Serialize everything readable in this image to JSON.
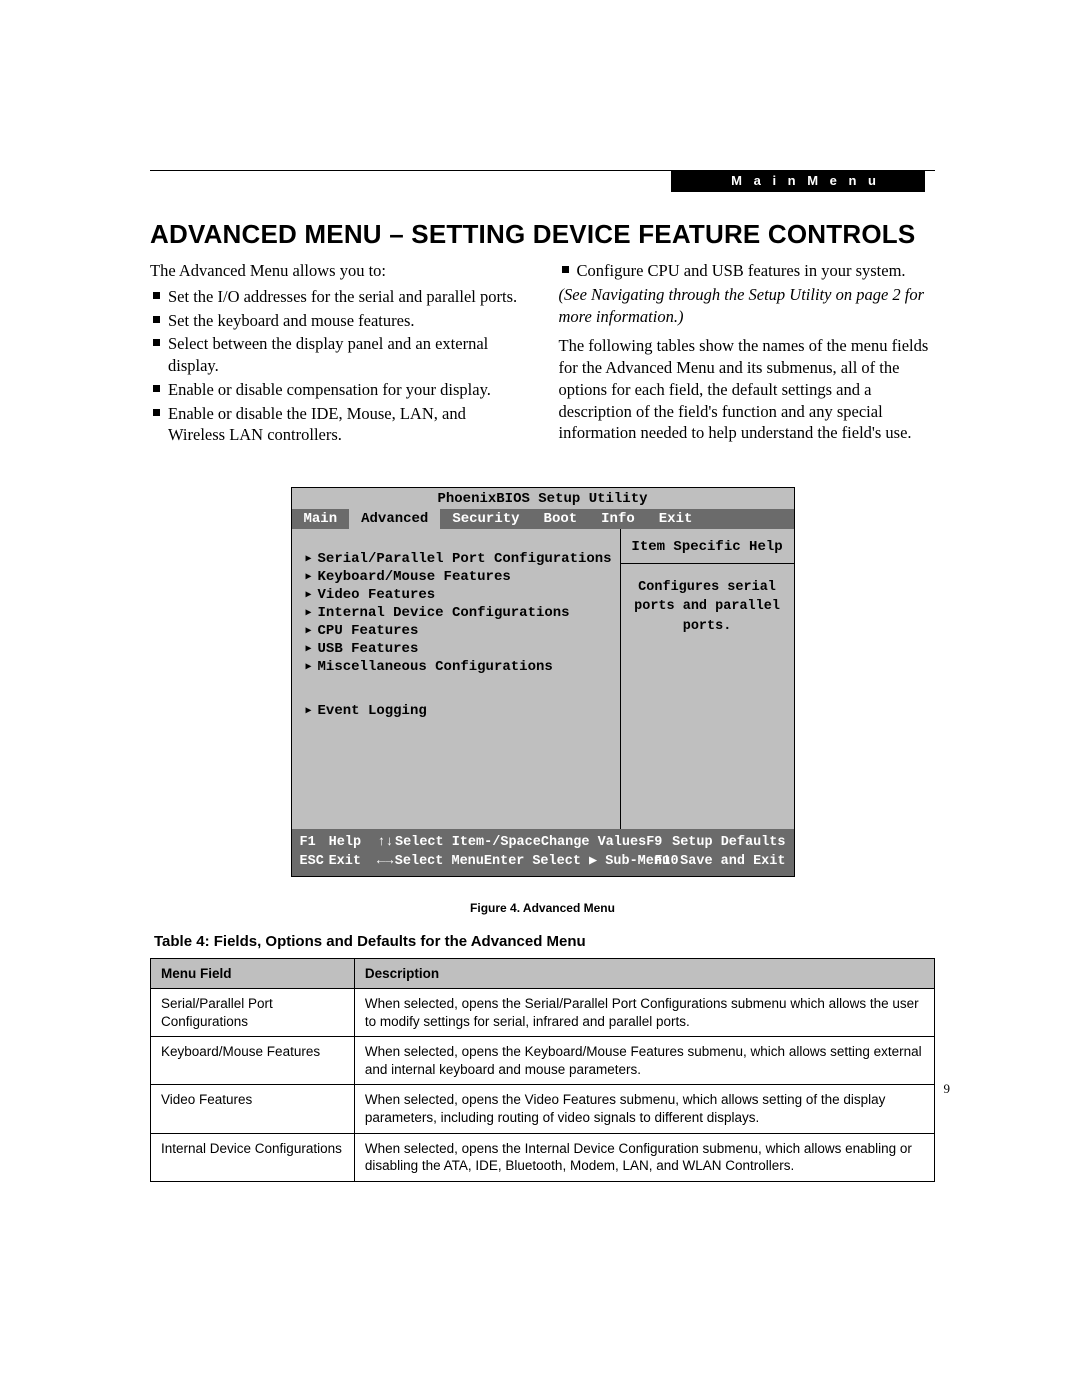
{
  "header": {
    "tag": "M a i n   M e n u"
  },
  "title": "ADVANCED MENU – SETTING DEVICE FEATURE CONTROLS",
  "intro": "The Advanced Menu allows you to:",
  "bullets_left": [
    "Set the I/O addresses for the serial and parallel ports.",
    "Set the keyboard and mouse features.",
    "Select between the display panel and an external display.",
    "Enable or disable compensation for your display.",
    "Enable or disable the IDE, Mouse, LAN, and Wireless LAN controllers."
  ],
  "bullet_right": "Configure CPU and USB features in your system.",
  "see_note": "(See Navigating through the Setup Utility on page 2 for more information.)",
  "para_right": "The following tables show the names of the menu fields for the Advanced Menu and its submenus, all of the options for each field, the default settings and a description of the field's function and any special information needed to help understand the field's use.",
  "bios": {
    "title": "PhoenixBIOS Setup Utility",
    "tabs": [
      "Main",
      "Advanced",
      "Security",
      "Boot",
      "Info",
      "Exit"
    ],
    "active_tab": "Advanced",
    "items_block1": [
      "Serial/Parallel Port Configurations",
      "Keyboard/Mouse Features",
      "Video Features",
      "Internal Device Configurations",
      "CPU Features",
      "USB Features",
      "Miscellaneous Configurations"
    ],
    "items_block2": [
      "Event Logging"
    ],
    "help_title": "Item Specific Help",
    "help_text": "Configures serial ports and parallel ports.",
    "footer": {
      "r1": {
        "k1": "F1",
        "k2": "Help",
        "arr1": "↑↓",
        "k3": "Select Item",
        "k4": "-/Space",
        "k5": "Change Values",
        "k6": "F9",
        "k7": "Setup Defaults"
      },
      "r2": {
        "k1": "ESC",
        "k2": "Exit",
        "arr1": "←→",
        "k3": "Select Menu",
        "k4": "Enter",
        "k5": "Select ▶ Sub-Menu",
        "k6": "F10",
        "k7": "Save and Exit"
      }
    }
  },
  "figure_caption": "Figure 4.  Advanced Menu",
  "table_title": "Table 4: Fields, Options and Defaults for the Advanced Menu",
  "table": {
    "headers": [
      "Menu Field",
      "Description"
    ],
    "rows": [
      {
        "field": "Serial/Parallel Port Configurations",
        "desc": "When selected, opens the Serial/Parallel Port Configurations submenu which allows the user to modify settings for serial, infrared and parallel ports."
      },
      {
        "field": "Keyboard/Mouse Features",
        "desc": "When selected, opens the Keyboard/Mouse Features submenu, which allows setting external and internal keyboard and mouse parameters."
      },
      {
        "field": "Video Features",
        "desc": "When selected, opens the Video Features submenu, which allows setting of the display parameters, including routing of video signals to different displays."
      },
      {
        "field": "Internal Device Configurations",
        "desc": "When selected, opens the Internal Device Configuration submenu, which allows enabling or disabling the ATA, IDE, Bluetooth, Modem, LAN, and WLAN Controllers."
      }
    ]
  },
  "page_number": "9"
}
